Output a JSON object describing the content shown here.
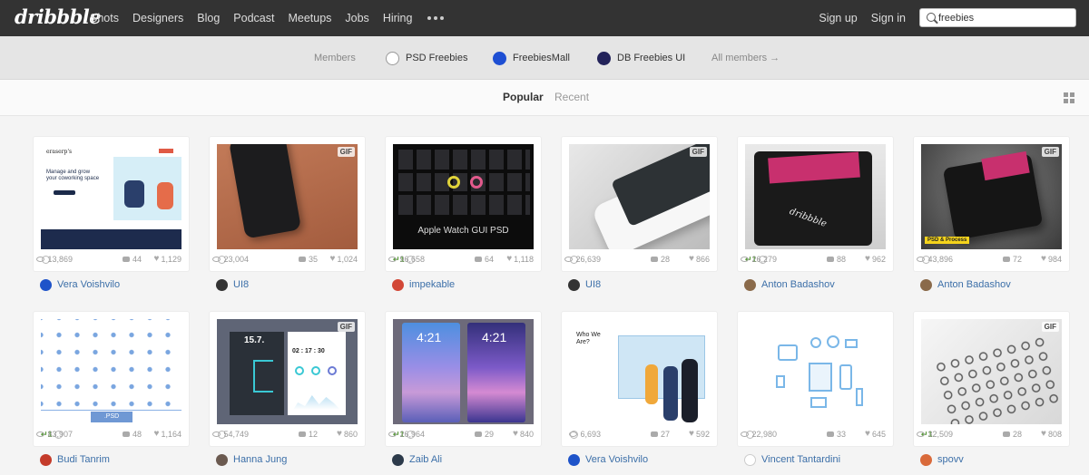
{
  "nav": {
    "logo": "dribbble",
    "links": [
      "Shots",
      "Designers",
      "Blog",
      "Podcast",
      "Meetups",
      "Jobs",
      "Hiring"
    ],
    "sign_up": "Sign up",
    "sign_in": "Sign in",
    "search_value": "freebies"
  },
  "members": {
    "label": "Members",
    "items": [
      {
        "name": "PSD Freebies",
        "color": "#7a5a2a"
      },
      {
        "name": "FreebiesMall",
        "color": "#1e4fd3"
      },
      {
        "name": "DB Freebies UI",
        "color": "#23235a"
      }
    ],
    "all": "All members →"
  },
  "sort": {
    "popular": "Popular",
    "recent": "Recent"
  },
  "shots": [
    {
      "author": "Vera Voishvilo",
      "views": "13,869",
      "comments": "44",
      "likes": "1,129",
      "rebounds": "",
      "gif": false,
      "avatar": "#1e53c9"
    },
    {
      "author": "UI8",
      "views": "23,004",
      "comments": "35",
      "likes": "1,024",
      "rebounds": "",
      "gif": true,
      "avatar": "#333333"
    },
    {
      "author": "impekable",
      "views": "96,658",
      "comments": "64",
      "likes": "1,118",
      "rebounds": "1",
      "gif": false,
      "avatar": "#d24736"
    },
    {
      "author": "UI8",
      "views": "26,639",
      "comments": "28",
      "likes": "866",
      "rebounds": "",
      "gif": true,
      "avatar": "#333333"
    },
    {
      "author": "Anton Badashov",
      "views": "26,279",
      "comments": "88",
      "likes": "962",
      "rebounds": "1",
      "gif": false,
      "avatar": "#8a6a4a"
    },
    {
      "author": "Anton Badashov",
      "views": "43,896",
      "comments": "72",
      "likes": "984",
      "rebounds": "",
      "gif": true,
      "avatar": "#8a6a4a"
    },
    {
      "author": "Budi Tanrim",
      "views": "83,907",
      "comments": "48",
      "likes": "1,164",
      "rebounds": "1",
      "gif": false,
      "avatar": "#c43b2a"
    },
    {
      "author": "Hanna Jung",
      "views": "54,749",
      "comments": "12",
      "likes": "860",
      "rebounds": "",
      "gif": true,
      "avatar": "#6b5a50"
    },
    {
      "author": "Zaib Ali",
      "views": "26,964",
      "comments": "29",
      "likes": "840",
      "rebounds": "1",
      "gif": false,
      "avatar": "#2c3a4a"
    },
    {
      "author": "Vera Voishvilo",
      "views": "6,693",
      "comments": "27",
      "likes": "592",
      "rebounds": "",
      "gif": false,
      "avatar": "#1e53c9"
    },
    {
      "author": "Vincent Tantardini",
      "views": "22,980",
      "comments": "33",
      "likes": "645",
      "rebounds": "",
      "gif": false,
      "avatar": "#cccccc"
    },
    {
      "author": "spovv",
      "views": "32,509",
      "comments": "28",
      "likes": "808",
      "rebounds": "1",
      "gif": true,
      "avatar": "#d96a3a"
    }
  ],
  "thumb_text": {
    "apple_watch": "Apple Watch GUI PSD",
    "psd_process": "PSD & Process",
    "psd": ".PSD",
    "time_a": "15.7.",
    "time_b": "02 : 17 : 30",
    "lock_time": "4:21",
    "who": "Who We Are?",
    "wallet": "dribbble",
    "cowork_logo": "eraserp's",
    "cowork_headline": "Manage and grow your coworking space"
  }
}
